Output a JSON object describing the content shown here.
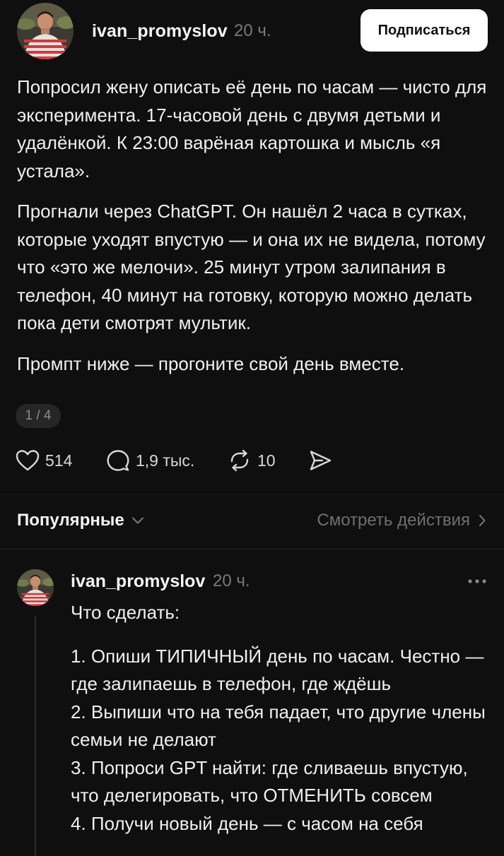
{
  "post": {
    "username": "ivan_promyslov",
    "time": "20 ч.",
    "subscribe_label": "Подписаться",
    "paragraphs": [
      "Попросил жену описать её день по часам — чисто для эксперимента. 17-часовой день с двумя детьми и удалёнкой. К 23:00 варёная картошка и мысль «я устала».",
      "Прогнали через ChatGPT. Он нашёл 2 часа в сутках, которые уходят впустую — и она их не видела, потому что «это же мелочи». 25 минут утром залипания в телефон, 40 минут на готовку, которую можно делать пока дети смотрят мультик.",
      "Промпт ниже — прогоните свой день вместе."
    ],
    "page_counter": "1 / 4",
    "actions": {
      "likes": "514",
      "comments": "1,9 тыс.",
      "reposts": "10"
    }
  },
  "sort_bar": {
    "sort_label": "Популярные",
    "view_activity_label": "Смотреть действия"
  },
  "reply": {
    "username": "ivan_promyslov",
    "time": "20 ч.",
    "intro": "Что сделать:",
    "items": [
      "1. Опиши ТИПИЧНЫЙ день по часам. Честно — где залипаешь в телефон, где ждёшь",
      "2. Выпиши что на тебя падает, что другие члены семьи не делают",
      "3. Попроси GPT найти: где сливаешь впустую, что делегировать, что ОТМЕНИТЬ совсем",
      "4. Получи новый день — с часом на себя"
    ]
  },
  "colors": {
    "background": "#0f0f0f",
    "text": "#f0f0f0",
    "muted": "#7a7a7a",
    "button_bg": "#ffffff"
  },
  "icons": [
    "heart-icon",
    "comment-icon",
    "repost-icon",
    "share-icon",
    "chevron-down-icon",
    "chevron-right-icon",
    "more-icon"
  ]
}
